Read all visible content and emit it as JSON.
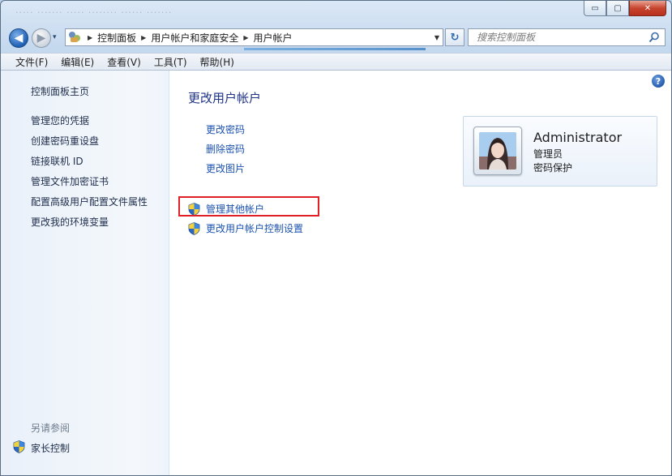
{
  "window": {
    "title_ghost": "····· ·······  ····· ········ ······ ·······",
    "min_label": "▭",
    "max_label": "▢",
    "close_label": "✕"
  },
  "nav": {
    "back": "◀",
    "forward": "▶",
    "history": "▾",
    "breadcrumbs": [
      "控制面板",
      "用户帐户和家庭安全",
      "用户帐户"
    ],
    "separator": "▶",
    "dropdown": "▼",
    "refresh": "↻",
    "search_placeholder": "搜索控制面板"
  },
  "menu": [
    "文件(F)",
    "编辑(E)",
    "查看(V)",
    "工具(T)",
    "帮助(H)"
  ],
  "sidebar": {
    "home": "控制面板主页",
    "links": [
      "管理您的凭据",
      "创建密码重设盘",
      "链接联机 ID",
      "管理文件加密证书",
      "配置高级用户配置文件属性",
      "更改我的环境变量"
    ],
    "see_also_heading": "另请参阅",
    "see_also_links": [
      "家长控制"
    ]
  },
  "main": {
    "title": "更改用户帐户",
    "links": [
      "更改密码",
      "删除密码",
      "更改图片"
    ],
    "admin_links": [
      "管理其他帐户",
      "更改用户帐户控制设置"
    ],
    "help": "?"
  },
  "user": {
    "name": "Administrator",
    "role": "管理员",
    "password_status": "密码保护"
  },
  "icons": {
    "shield": "uac-shield-icon",
    "search": "search-icon",
    "control-panel": "control-panel-icon"
  },
  "colors": {
    "link": "#1a51b0",
    "title": "#1e3287",
    "highlight": "#e02026"
  }
}
